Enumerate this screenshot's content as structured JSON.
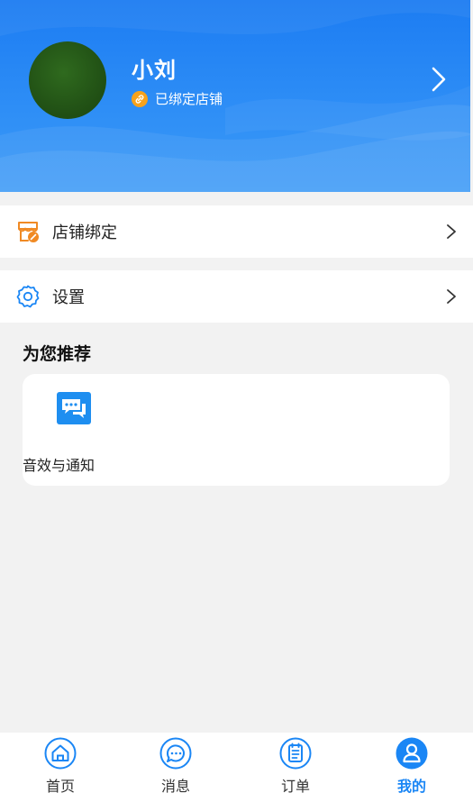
{
  "profile": {
    "name": "小刘",
    "bind_status": "已绑定店铺",
    "avatar_icon": "avatar",
    "arrow_icon": "chevron-right-icon"
  },
  "menu": [
    {
      "label": "店铺绑定",
      "icon": "store-bind-icon",
      "arrow_icon": "chevron-right-icon"
    },
    {
      "label": "设置",
      "icon": "gear-icon",
      "arrow_icon": "chevron-right-icon"
    }
  ],
  "recommend": {
    "title": "为您推荐",
    "items": [
      {
        "label": "音效与通知",
        "icon": "chat-bubbles-icon"
      }
    ]
  },
  "tabbar": {
    "items": [
      {
        "label": "首页",
        "icon": "home-icon",
        "active": false
      },
      {
        "label": "消息",
        "icon": "message-icon",
        "active": false
      },
      {
        "label": "订单",
        "icon": "order-list-icon",
        "active": false
      },
      {
        "label": "我的",
        "icon": "user-icon",
        "active": true
      }
    ]
  },
  "colors": {
    "header_blue": "#1c7cf2",
    "accent_blue": "#1a86f5",
    "orange": "#f08a24",
    "badge_orange": "#f7a21b",
    "page_bg": "#f2f2f2"
  }
}
